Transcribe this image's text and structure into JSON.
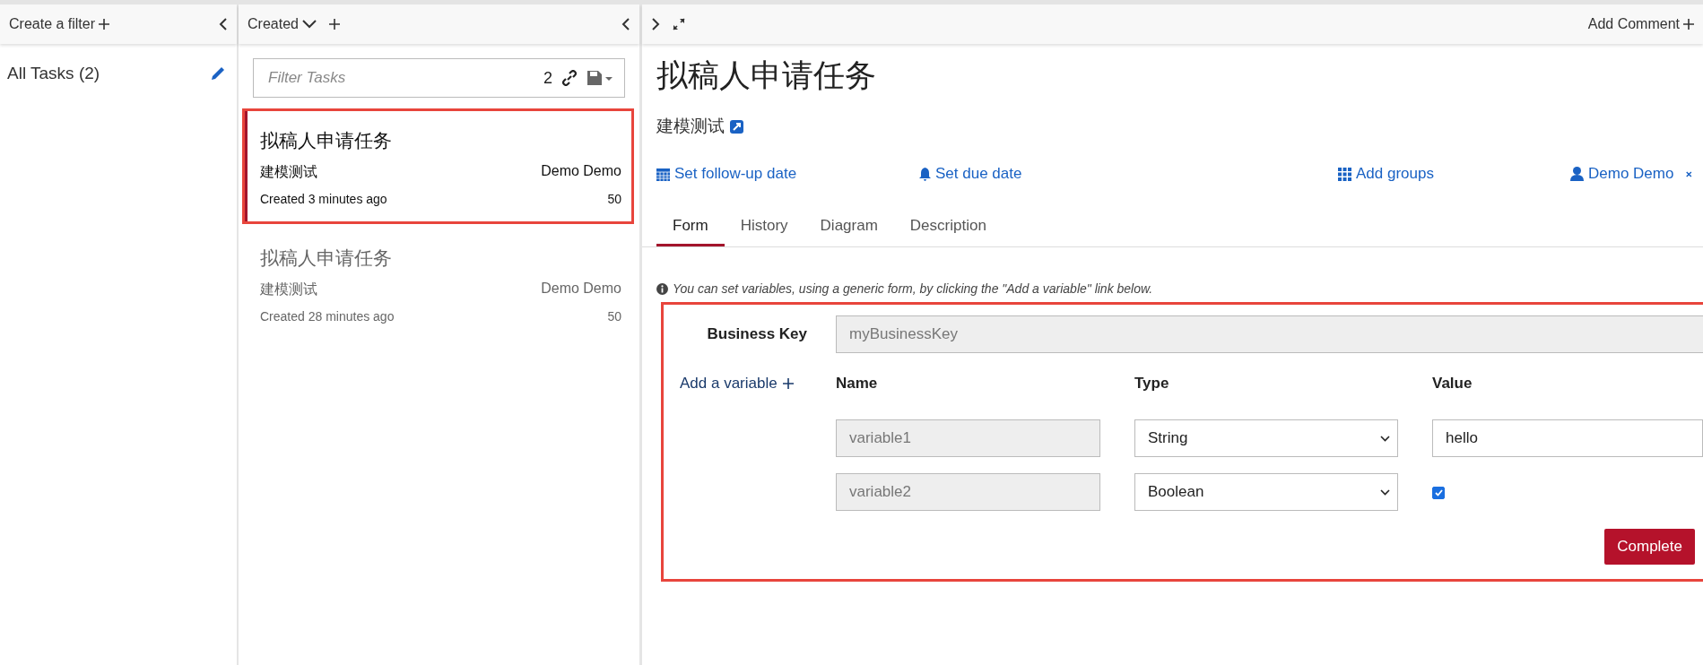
{
  "filters_panel": {
    "header": "Create a filter",
    "items": [
      {
        "label": "All Tasks (2)",
        "selected": true
      }
    ]
  },
  "tasks_panel": {
    "sort_label": "Created",
    "search": {
      "placeholder": "Filter Tasks",
      "count": "2"
    },
    "tasks": [
      {
        "title": "拟稿人申请任务",
        "process": "建模测试",
        "assignee": "Demo Demo",
        "created": "Created 3 minutes ago",
        "priority": "50",
        "selected": true,
        "highlighted": true
      },
      {
        "title": "拟稿人申请任务",
        "process": "建模测试",
        "assignee": "Demo Demo",
        "created": "Created 28 minutes ago",
        "priority": "50",
        "selected": false,
        "highlighted": false
      }
    ]
  },
  "task_detail": {
    "add_comment": "Add Comment",
    "title": "拟稿人申请任务",
    "process": "建模测试",
    "actions": [
      {
        "kind": "calendar",
        "label": "Set follow-up date"
      },
      {
        "kind": "bell",
        "label": "Set due date"
      },
      {
        "kind": "groups",
        "label": "Add groups"
      },
      {
        "kind": "user",
        "label": "Demo Demo"
      }
    ],
    "tabs": [
      {
        "label": "Form",
        "selected": true
      },
      {
        "label": "History",
        "selected": false
      },
      {
        "label": "Diagram",
        "selected": false
      },
      {
        "label": "Description",
        "selected": false
      }
    ],
    "info": "You can set variables, using a generic form, by clicking the \"Add a variable\" link below.",
    "form": {
      "highlighted": true,
      "business_key_label": "Business Key",
      "business_key": "myBusinessKey",
      "add_variable": "Add a variable",
      "columns": [
        "Name",
        "Type",
        "Value"
      ],
      "variables": [
        {
          "name": "variable1",
          "type": "String",
          "kind": "text",
          "value": "hello"
        },
        {
          "name": "variable2",
          "type": "Boolean",
          "kind": "checkbox",
          "checked": true
        }
      ],
      "submit": "Complete"
    }
  }
}
